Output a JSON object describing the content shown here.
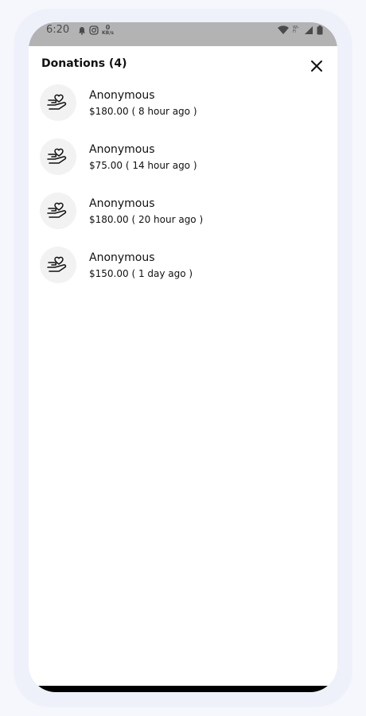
{
  "status_bar": {
    "time": "6:20",
    "speed_value": "0",
    "speed_unit": "KB/s",
    "wifi_label": "Wi-Fi",
    "icons": [
      "notification-bell-icon",
      "instagram-icon",
      "wifi-icon",
      "signal-icon",
      "battery-icon"
    ]
  },
  "header": {
    "title": "Donations (4)",
    "close_icon": "close-icon"
  },
  "donations": [
    {
      "name": "Anonymous",
      "amount": "$180.00",
      "time": "( 8 hour ago )",
      "icon": "hand-heart-icon"
    },
    {
      "name": "Anonymous",
      "amount": "$75.00",
      "time": "( 14 hour ago )",
      "icon": "hand-heart-icon"
    },
    {
      "name": "Anonymous",
      "amount": "$180.00",
      "time": "( 20 hour ago )",
      "icon": "hand-heart-icon"
    },
    {
      "name": "Anonymous",
      "amount": "$150.00",
      "time": "( 1 day ago )",
      "icon": "hand-heart-icon"
    }
  ],
  "colors": {
    "status_bar": "#b3b3b3",
    "avatar_bg": "#f2f2f2",
    "text": "#111111",
    "background": "#ffffff"
  }
}
